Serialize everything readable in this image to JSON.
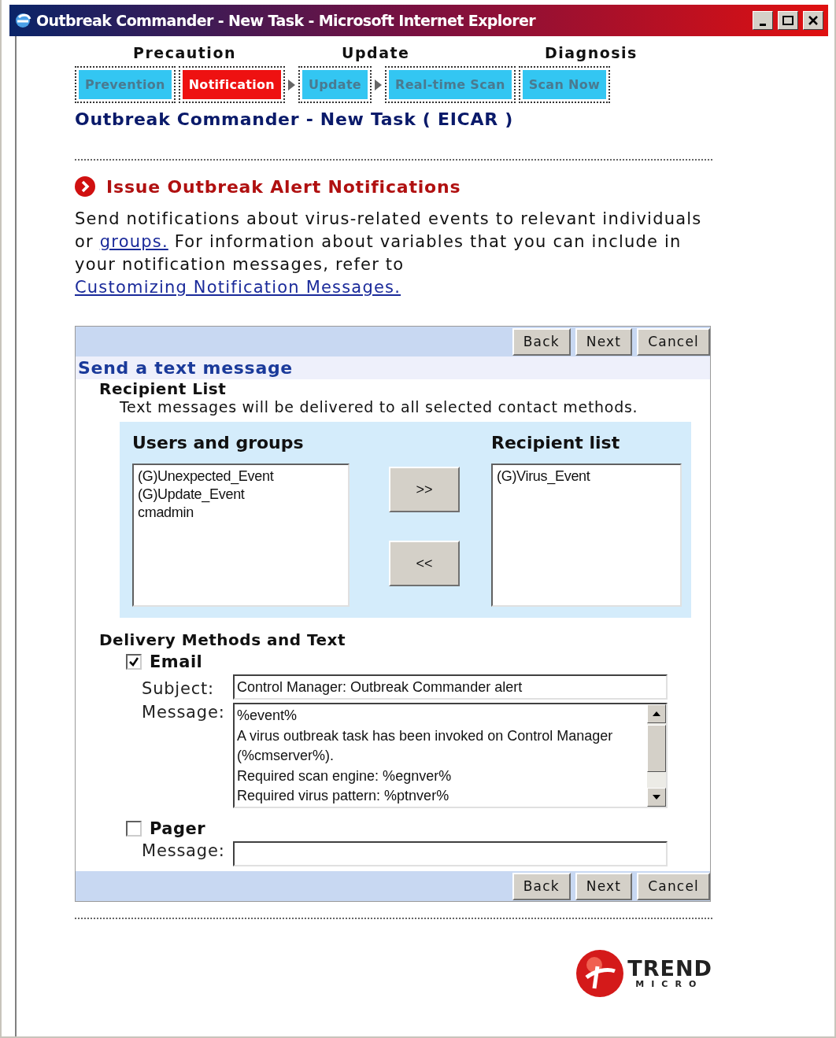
{
  "window": {
    "title": "Outbreak Commander - New Task - Microsoft Internet Explorer"
  },
  "phases": [
    "Precaution",
    "Update",
    "Diagnosis"
  ],
  "steps": [
    {
      "kind": "step",
      "label": "Prevention",
      "selected": false
    },
    {
      "kind": "step",
      "label": "Notification",
      "selected": true
    },
    {
      "kind": "arrow"
    },
    {
      "kind": "step",
      "label": "Update",
      "selected": false
    },
    {
      "kind": "arrow"
    },
    {
      "kind": "step",
      "label": "Real-time Scan",
      "selected": false
    },
    {
      "kind": "step",
      "label": "Scan Now",
      "selected": false
    }
  ],
  "page_title": "Outbreak Commander - New Task ( EICAR )",
  "section_title": "Issue Outbreak Alert Notifications",
  "intro": [
    {
      "text": "Send notifications about virus-related events to relevant individuals or ",
      "kind": "text"
    },
    {
      "text": "groups.",
      "kind": "link"
    },
    {
      "text": " For information about variables that you can include in your notification messages, refer to ",
      "kind": "text"
    },
    {
      "text": "Customizing Notification Messages.",
      "kind": "link"
    }
  ],
  "buttons_top": [
    "Back",
    "Next",
    "Cancel"
  ],
  "form": {
    "title": "Send a text message",
    "recipient_heading": "Recipient List",
    "recipient_note": "Text messages will be delivered to all selected contact methods.",
    "users_label": "Users and groups",
    "recipients_label": "Recipient list",
    "users": [
      "(G)Unexpected_Event",
      "(G)Update_Event",
      "cmadmin"
    ],
    "recipients": [
      "(G)Virus_Event"
    ],
    "add_button": ">>",
    "remove_button": "<<",
    "delivery_heading": "Delivery Methods and Text",
    "email": {
      "label": "Email",
      "checked": true,
      "subject_label": "Subject:",
      "subject": "Control Manager: Outbreak Commander alert",
      "message_label": "Message:",
      "message": [
        "%event%",
        "A virus outbreak task has been invoked on Control Manager (%cmserver%).",
        "Required scan engine: %egnver%",
        "Required virus pattern: %ptnver%"
      ]
    },
    "pager": {
      "label": "Pager",
      "checked": false,
      "message_label": "Message:"
    }
  },
  "buttons_bottom": [
    "Back",
    "Next",
    "Cancel"
  ],
  "logo": {
    "name": "TREND",
    "sub": "MICRO"
  }
}
